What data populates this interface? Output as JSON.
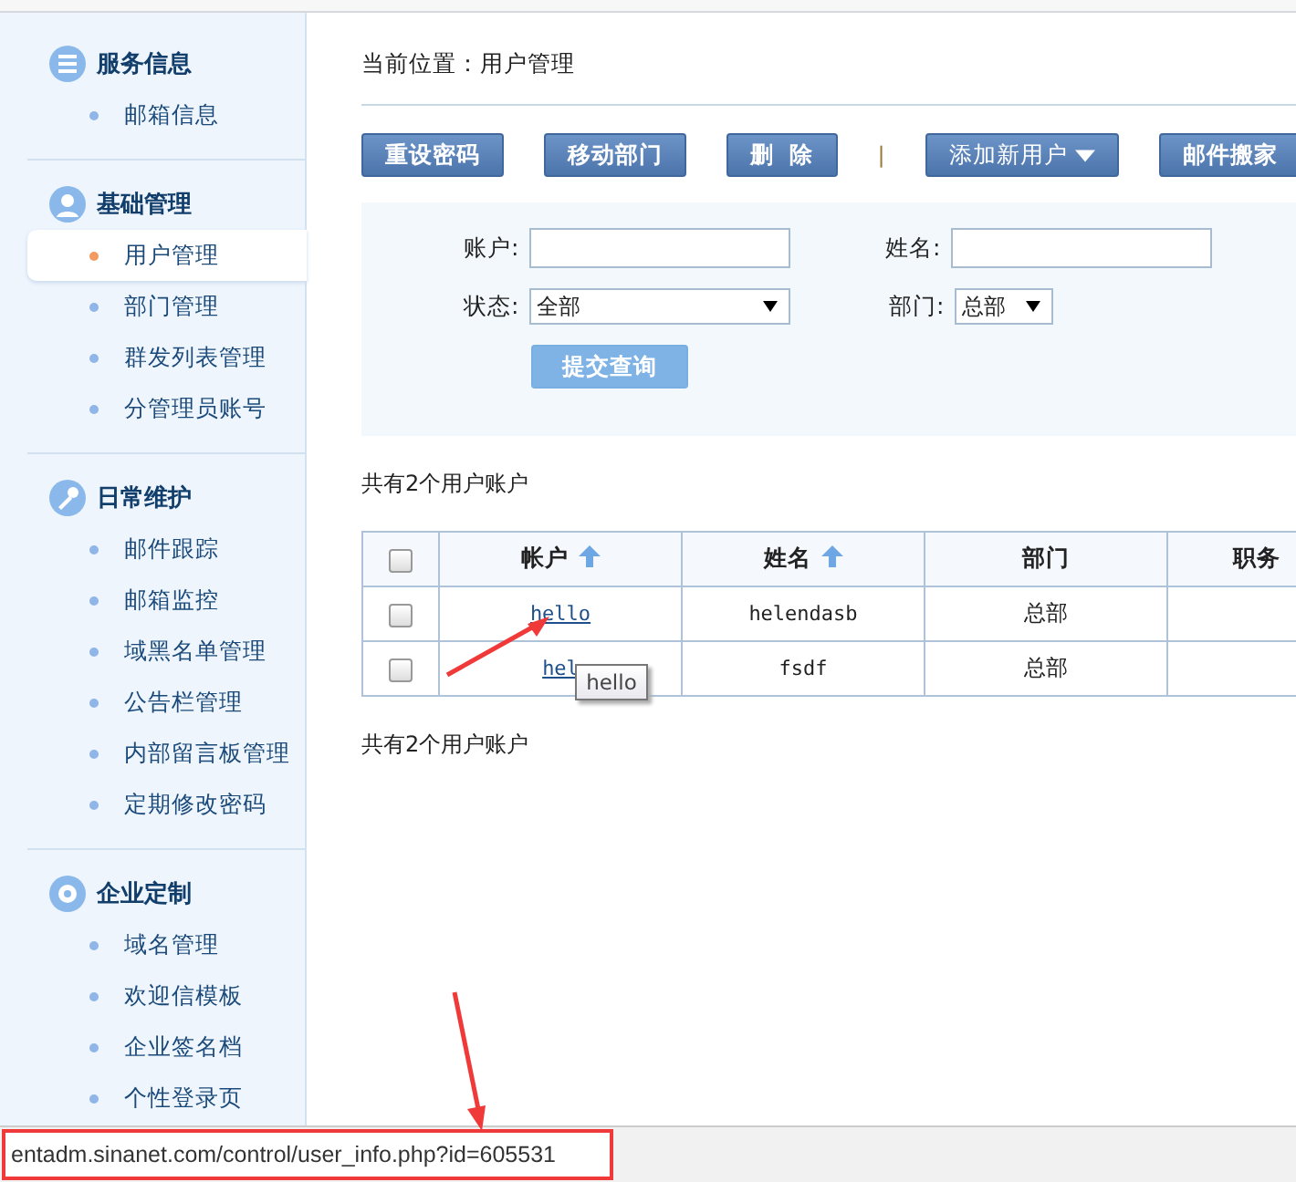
{
  "sidebar": {
    "sections": [
      {
        "title": "服务信息",
        "items": [
          {
            "label": "邮箱信息",
            "selected": false
          }
        ]
      },
      {
        "title": "基础管理",
        "items": [
          {
            "label": "用户管理",
            "selected": true
          },
          {
            "label": "部门管理",
            "selected": false
          },
          {
            "label": "群发列表管理",
            "selected": false
          },
          {
            "label": "分管理员账号",
            "selected": false
          }
        ]
      },
      {
        "title": "日常维护",
        "items": [
          {
            "label": "邮件跟踪",
            "selected": false
          },
          {
            "label": "邮箱监控",
            "selected": false
          },
          {
            "label": "域黑名单管理",
            "selected": false
          },
          {
            "label": "公告栏管理",
            "selected": false
          },
          {
            "label": "内部留言板管理",
            "selected": false
          },
          {
            "label": "定期修改密码",
            "selected": false
          }
        ]
      },
      {
        "title": "企业定制",
        "items": [
          {
            "label": "域名管理",
            "selected": false
          },
          {
            "label": "欢迎信模板",
            "selected": false
          },
          {
            "label": "企业签名档",
            "selected": false
          },
          {
            "label": "个性登录页",
            "selected": false
          }
        ]
      }
    ]
  },
  "breadcrumb": "当前位置：用户管理",
  "toolbar": [
    {
      "label": "重设密码",
      "kind": "button"
    },
    {
      "label": "移动部门",
      "kind": "button"
    },
    {
      "label": "删  除",
      "kind": "button"
    },
    {
      "label": "|",
      "kind": "separator"
    },
    {
      "label": "添加新用户",
      "kind": "dropdown"
    },
    {
      "label": "邮件搬家",
      "kind": "button"
    }
  ],
  "filter": {
    "account_label": "账户:",
    "name_label": "姓名:",
    "status_label": "状态:",
    "status_value": "全部",
    "dept_label": "部门:",
    "dept_value": "总部",
    "submit": "提交查询"
  },
  "count_top": "共有2个用户账户",
  "table": {
    "all_checked": false,
    "columns": [
      {
        "label": "帐户",
        "sortable": true
      },
      {
        "label": "姓名",
        "sortable": true
      },
      {
        "label": "部门",
        "sortable": false
      },
      {
        "label": "职务",
        "sortable": false
      }
    ],
    "rows": [
      {
        "checked": false,
        "account": "hello",
        "name": "helendasb",
        "dept": "总部"
      },
      {
        "checked": false,
        "account": "hel",
        "name": "fsdf",
        "dept": "总部"
      }
    ]
  },
  "tooltip": "hello",
  "count_bottom": "共有2个用户账户",
  "status_bar": "entadm.sinanet.com/control/user_info.php?id=605531"
}
